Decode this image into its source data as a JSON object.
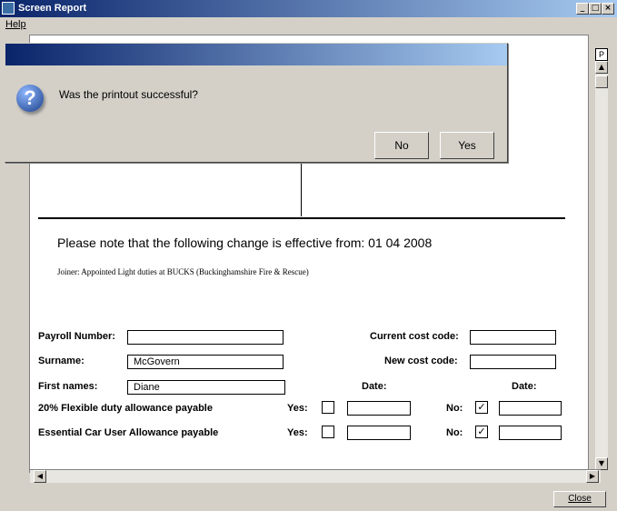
{
  "window": {
    "title": "Screen Report",
    "min": "_",
    "max": "□",
    "close": "×"
  },
  "menu": {
    "help": "Help"
  },
  "report": {
    "heading": "Please note that the following change is effective from: 01 04 2008",
    "subtext": "Joiner: Appointed Light duties at BUCKS (Buckinghamshire Fire & Rescue)",
    "payroll_label": "Payroll Number:",
    "payroll_value": "",
    "surname_label": "Surname:",
    "surname_value": "McGovern",
    "firstnames_label": "First names:",
    "firstnames_value": "Diane",
    "current_cost_label": "Current cost code:",
    "current_cost_value": "",
    "new_cost_label": "New cost code:",
    "new_cost_value": "",
    "date_label_1": "Date:",
    "date_label_2": "Date:",
    "flex_label": "20% Flexible duty allowance payable",
    "car_label": "Essential Car User Allowance payable",
    "yes_label": "Yes:",
    "no_label": "No:",
    "check": "✓",
    "flex_yes_checked": false,
    "flex_no_checked": true,
    "car_yes_checked": false,
    "car_no_checked": true
  },
  "p_marker": "P",
  "footer": {
    "close": "Close"
  },
  "dialog": {
    "message": "Was the printout successful?",
    "no": "No",
    "yes": "Yes",
    "icon": "question-icon"
  }
}
